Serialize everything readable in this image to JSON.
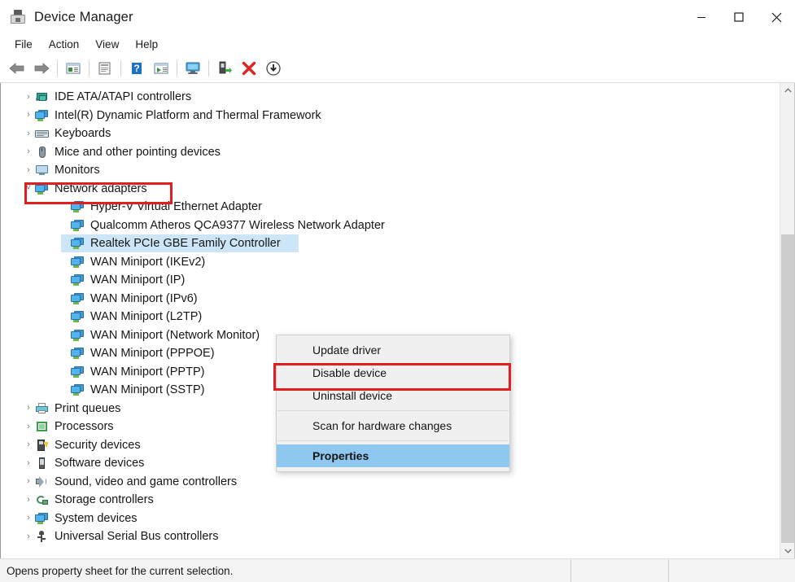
{
  "window": {
    "title": "Device Manager",
    "icon": "device-manager-icon",
    "controls": {
      "minimize": "minimize-icon",
      "maximize": "maximize-icon",
      "close": "close-icon"
    }
  },
  "menubar": {
    "items": [
      {
        "label": "File"
      },
      {
        "label": "Action"
      },
      {
        "label": "View"
      },
      {
        "label": "Help"
      }
    ]
  },
  "toolbar": {
    "buttons": [
      {
        "name": "back-icon",
        "title": "Back"
      },
      {
        "name": "forward-icon",
        "title": "Forward"
      },
      {
        "name": "show-hidden-devices-icon",
        "title": "Show hidden devices"
      },
      {
        "name": "properties-icon",
        "title": "Properties"
      },
      {
        "name": "help-icon",
        "title": "Help"
      },
      {
        "name": "update-driver-icon",
        "title": "Update driver"
      },
      {
        "name": "scan-for-hardware-changes-icon",
        "title": "Scan for hardware changes"
      },
      {
        "name": "enable-device-icon",
        "title": "Enable device"
      },
      {
        "name": "uninstall-device-icon",
        "title": "Uninstall device"
      },
      {
        "name": "disable-device-icon",
        "title": "Disable device"
      }
    ]
  },
  "tree": {
    "rows": [
      {
        "label": "IDE ATA/ATAPI controllers",
        "level": 1,
        "chevron": "collapsed",
        "icon": "ide-controller-icon",
        "selected": false
      },
      {
        "label": "Intel(R) Dynamic Platform and Thermal Framework",
        "level": 1,
        "chevron": "collapsed",
        "icon": "system-device-icon",
        "selected": false
      },
      {
        "label": "Keyboards",
        "level": 1,
        "chevron": "collapsed",
        "icon": "keyboard-icon",
        "selected": false
      },
      {
        "label": "Mice and other pointing devices",
        "level": 1,
        "chevron": "collapsed",
        "icon": "mouse-icon",
        "selected": false
      },
      {
        "label": "Monitors",
        "level": 1,
        "chevron": "collapsed",
        "icon": "monitor-icon",
        "selected": false
      },
      {
        "label": "Network adapters",
        "level": 1,
        "chevron": "expanded",
        "icon": "network-adapter-icon",
        "selected": false
      },
      {
        "label": "Hyper-V Virtual Ethernet Adapter",
        "level": 2,
        "chevron": "none",
        "icon": "network-adapter-icon",
        "selected": false
      },
      {
        "label": "Qualcomm Atheros QCA9377 Wireless Network Adapter",
        "level": 2,
        "chevron": "none",
        "icon": "network-adapter-icon",
        "selected": false
      },
      {
        "label": "Realtek PCIe GBE Family Controller",
        "level": 2,
        "chevron": "none",
        "icon": "network-adapter-icon",
        "selected": true
      },
      {
        "label": "WAN Miniport (IKEv2)",
        "level": 2,
        "chevron": "none",
        "icon": "network-adapter-icon",
        "selected": false
      },
      {
        "label": "WAN Miniport (IP)",
        "level": 2,
        "chevron": "none",
        "icon": "network-adapter-icon",
        "selected": false
      },
      {
        "label": "WAN Miniport (IPv6)",
        "level": 2,
        "chevron": "none",
        "icon": "network-adapter-icon",
        "selected": false
      },
      {
        "label": "WAN Miniport (L2TP)",
        "level": 2,
        "chevron": "none",
        "icon": "network-adapter-icon",
        "selected": false
      },
      {
        "label": "WAN Miniport (Network Monitor)",
        "level": 2,
        "chevron": "none",
        "icon": "network-adapter-icon",
        "selected": false
      },
      {
        "label": "WAN Miniport (PPPOE)",
        "level": 2,
        "chevron": "none",
        "icon": "network-adapter-icon",
        "selected": false
      },
      {
        "label": "WAN Miniport (PPTP)",
        "level": 2,
        "chevron": "none",
        "icon": "network-adapter-icon",
        "selected": false
      },
      {
        "label": "WAN Miniport (SSTP)",
        "level": 2,
        "chevron": "none",
        "icon": "network-adapter-icon",
        "selected": false
      },
      {
        "label": "Print queues",
        "level": 1,
        "chevron": "collapsed",
        "icon": "printer-icon",
        "selected": false
      },
      {
        "label": "Processors",
        "level": 1,
        "chevron": "collapsed",
        "icon": "processor-icon",
        "selected": false
      },
      {
        "label": "Security devices",
        "level": 1,
        "chevron": "collapsed",
        "icon": "security-device-icon",
        "selected": false
      },
      {
        "label": "Software devices",
        "level": 1,
        "chevron": "collapsed",
        "icon": "software-device-icon",
        "selected": false
      },
      {
        "label": "Sound, video and game controllers",
        "level": 1,
        "chevron": "collapsed",
        "icon": "sound-controller-icon",
        "selected": false
      },
      {
        "label": "Storage controllers",
        "level": 1,
        "chevron": "collapsed",
        "icon": "storage-controller-icon",
        "selected": false
      },
      {
        "label": "System devices",
        "level": 1,
        "chevron": "collapsed",
        "icon": "system-device-icon",
        "selected": false
      },
      {
        "label": "Universal Serial Bus controllers",
        "level": 1,
        "chevron": "collapsed",
        "icon": "usb-controller-icon",
        "selected": false
      }
    ]
  },
  "context_menu": {
    "items": [
      {
        "label": "Update driver",
        "highlighted": false,
        "separator_after": false
      },
      {
        "label": "Disable device",
        "highlighted": false,
        "separator_after": false
      },
      {
        "label": "Uninstall device",
        "highlighted": false,
        "separator_after": true
      },
      {
        "label": "Scan for hardware changes",
        "highlighted": false,
        "separator_after": true
      },
      {
        "label": "Properties",
        "highlighted": true,
        "separator_after": false
      }
    ]
  },
  "statusbar": {
    "message": "Opens property sheet for the current selection.",
    "pane2": "",
    "pane3": ""
  },
  "annotations": {
    "highlight_color": "#e02020",
    "boxes": [
      {
        "name": "network-adapters-highlight"
      },
      {
        "name": "properties-highlight"
      }
    ]
  },
  "colors": {
    "selection": "#cde6f7",
    "menu_highlight": "#8ec8f0",
    "accent_red": "#e02020"
  }
}
